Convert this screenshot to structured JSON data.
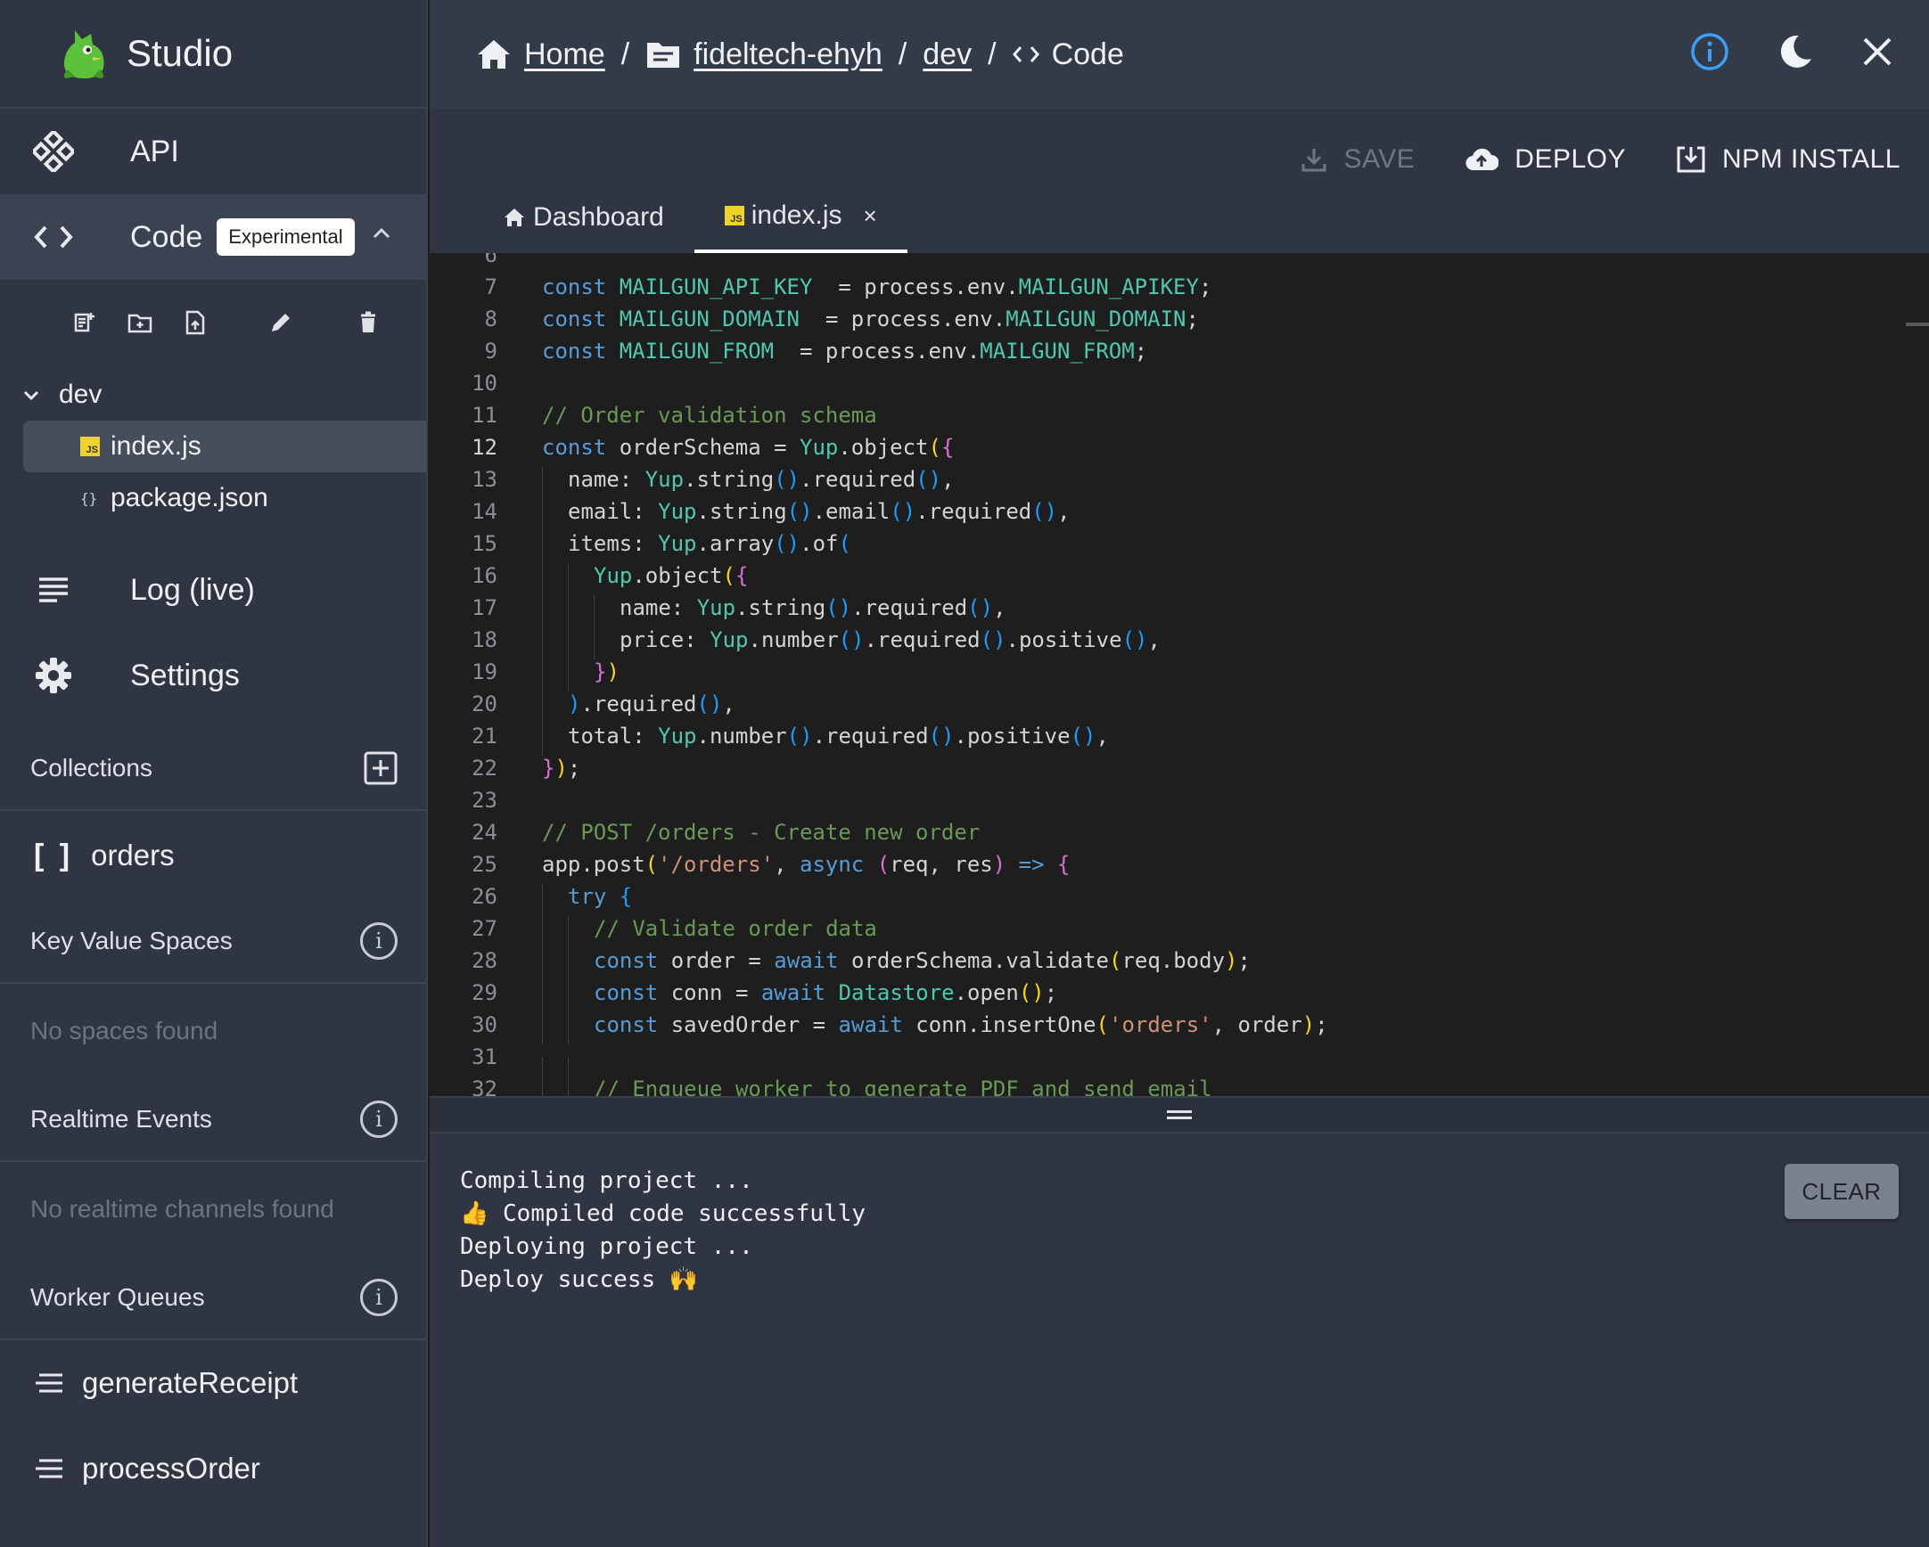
{
  "brand": {
    "name": "Studio"
  },
  "nav": {
    "api": "API",
    "code": "Code",
    "code_badge": "Experimental",
    "log": "Log (live)",
    "settings": "Settings"
  },
  "tree": {
    "folder": "dev",
    "files": [
      "index.js",
      "package.json"
    ]
  },
  "collections": {
    "title": "Collections",
    "items": [
      "orders"
    ]
  },
  "kv": {
    "title": "Key Value Spaces",
    "empty": "No spaces found"
  },
  "realtime": {
    "title": "Realtime Events",
    "empty": "No realtime channels found"
  },
  "workers": {
    "title": "Worker Queues",
    "items": [
      "generateReceipt",
      "processOrder"
    ]
  },
  "breadcrumb": {
    "home": "Home",
    "project": "fideltech-ehyh",
    "space": "dev",
    "current": "Code",
    "separator": "/"
  },
  "actions": {
    "save": "SAVE",
    "deploy": "DEPLOY",
    "npm": "NPM INSTALL"
  },
  "tabs": {
    "dashboard": "Dashboard",
    "file": "index.js",
    "close": "×"
  },
  "code": {
    "current_line": 12,
    "lines": [
      {
        "n": 6,
        "indent": 0,
        "t": [
          [
            "",
            ""
          ]
        ]
      },
      {
        "n": 7,
        "indent": 0,
        "t": [
          [
            "kw",
            "const "
          ],
          [
            "cst",
            "MAILGUN_API_KEY"
          ],
          [
            "",
            "  = process.env."
          ],
          [
            "cst",
            "MAILGUN_APIKEY"
          ],
          [
            "",
            ";"
          ]
        ]
      },
      {
        "n": 8,
        "indent": 0,
        "t": [
          [
            "kw",
            "const "
          ],
          [
            "cst",
            "MAILGUN_DOMAIN"
          ],
          [
            "",
            "  = process.env."
          ],
          [
            "cst",
            "MAILGUN_DOMAIN"
          ],
          [
            "",
            ";"
          ]
        ]
      },
      {
        "n": 9,
        "indent": 0,
        "t": [
          [
            "kw",
            "const "
          ],
          [
            "cst",
            "MAILGUN_FROM"
          ],
          [
            "",
            "  = process.env."
          ],
          [
            "cst",
            "MAILGUN_FROM"
          ],
          [
            "",
            ";"
          ]
        ]
      },
      {
        "n": 10,
        "indent": 0,
        "t": []
      },
      {
        "n": 11,
        "indent": 0,
        "t": [
          [
            "com",
            "// Order validation schema"
          ]
        ]
      },
      {
        "n": 12,
        "indent": 0,
        "t": [
          [
            "kw",
            "const "
          ],
          [
            "",
            "orderSchema = "
          ],
          [
            "cst",
            "Yup"
          ],
          [
            "",
            ".object"
          ],
          [
            "p1",
            "("
          ],
          [
            "p2",
            "{"
          ]
        ]
      },
      {
        "n": 13,
        "indent": 1,
        "t": [
          [
            "",
            "name: "
          ],
          [
            "cst",
            "Yup"
          ],
          [
            "",
            ".string"
          ],
          [
            "p3",
            "()"
          ],
          [
            "",
            ".required"
          ],
          [
            "p3",
            "()"
          ],
          [
            "",
            ","
          ]
        ]
      },
      {
        "n": 14,
        "indent": 1,
        "t": [
          [
            "",
            "email: "
          ],
          [
            "cst",
            "Yup"
          ],
          [
            "",
            ".string"
          ],
          [
            "p3",
            "()"
          ],
          [
            "",
            ".email"
          ],
          [
            "p3",
            "()"
          ],
          [
            "",
            ".required"
          ],
          [
            "p3",
            "()"
          ],
          [
            "",
            ","
          ]
        ]
      },
      {
        "n": 15,
        "indent": 1,
        "t": [
          [
            "",
            "items: "
          ],
          [
            "cst",
            "Yup"
          ],
          [
            "",
            ".array"
          ],
          [
            "p3",
            "()"
          ],
          [
            "",
            ".of"
          ],
          [
            "p3",
            "("
          ]
        ]
      },
      {
        "n": 16,
        "indent": 2,
        "t": [
          [
            "cst",
            "Yup"
          ],
          [
            "",
            ".object"
          ],
          [
            "p1",
            "("
          ],
          [
            "p2",
            "{"
          ]
        ]
      },
      {
        "n": 17,
        "indent": 3,
        "t": [
          [
            "",
            "name: "
          ],
          [
            "cst",
            "Yup"
          ],
          [
            "",
            ".string"
          ],
          [
            "p3",
            "()"
          ],
          [
            "",
            ".required"
          ],
          [
            "p3",
            "()"
          ],
          [
            "",
            ","
          ]
        ]
      },
      {
        "n": 18,
        "indent": 3,
        "t": [
          [
            "",
            "price: "
          ],
          [
            "cst",
            "Yup"
          ],
          [
            "",
            ".number"
          ],
          [
            "p3",
            "()"
          ],
          [
            "",
            ".required"
          ],
          [
            "p3",
            "()"
          ],
          [
            "",
            ".positive"
          ],
          [
            "p3",
            "()"
          ],
          [
            "",
            ","
          ]
        ]
      },
      {
        "n": 19,
        "indent": 2,
        "t": [
          [
            "p2",
            "}"
          ],
          [
            "p1",
            ")"
          ]
        ]
      },
      {
        "n": 20,
        "indent": 1,
        "t": [
          [
            "p3",
            ")"
          ],
          [
            "",
            ".required"
          ],
          [
            "p3",
            "()"
          ],
          [
            "",
            ","
          ]
        ]
      },
      {
        "n": 21,
        "indent": 1,
        "t": [
          [
            "",
            "total: "
          ],
          [
            "cst",
            "Yup"
          ],
          [
            "",
            ".number"
          ],
          [
            "p3",
            "()"
          ],
          [
            "",
            ".required"
          ],
          [
            "p3",
            "()"
          ],
          [
            "",
            ".positive"
          ],
          [
            "p3",
            "()"
          ],
          [
            "",
            ","
          ]
        ]
      },
      {
        "n": 22,
        "indent": 0,
        "t": [
          [
            "p2",
            "}"
          ],
          [
            "p1",
            ")"
          ],
          [
            "",
            ";"
          ]
        ]
      },
      {
        "n": 23,
        "indent": 0,
        "t": []
      },
      {
        "n": 24,
        "indent": 0,
        "t": [
          [
            "com",
            "// POST /orders - Create new order"
          ]
        ]
      },
      {
        "n": 25,
        "indent": 0,
        "t": [
          [
            "",
            "app.post"
          ],
          [
            "p1",
            "("
          ],
          [
            "str",
            "'/orders'"
          ],
          [
            "",
            ", "
          ],
          [
            "kw",
            "async "
          ],
          [
            "p2",
            "("
          ],
          [
            "",
            "req, res"
          ],
          [
            "p2",
            ")"
          ],
          [
            "kw",
            " => "
          ],
          [
            "p2",
            "{"
          ]
        ]
      },
      {
        "n": 26,
        "indent": 1,
        "t": [
          [
            "kw",
            "try "
          ],
          [
            "p3",
            "{"
          ]
        ]
      },
      {
        "n": 27,
        "indent": 2,
        "t": [
          [
            "com",
            "// Validate order data"
          ]
        ]
      },
      {
        "n": 28,
        "indent": 2,
        "t": [
          [
            "kw",
            "const "
          ],
          [
            "",
            "order = "
          ],
          [
            "kw",
            "await "
          ],
          [
            "",
            "orderSchema.validate"
          ],
          [
            "p1",
            "("
          ],
          [
            "",
            "req.body"
          ],
          [
            "p1",
            ")"
          ],
          [
            "",
            ";"
          ]
        ]
      },
      {
        "n": 29,
        "indent": 2,
        "t": [
          [
            "kw",
            "const "
          ],
          [
            "",
            "conn = "
          ],
          [
            "kw",
            "await "
          ],
          [
            "cst",
            "Datastore"
          ],
          [
            "",
            ".open"
          ],
          [
            "p1",
            "()"
          ],
          [
            "",
            ";"
          ]
        ]
      },
      {
        "n": 30,
        "indent": 2,
        "t": [
          [
            "kw",
            "const "
          ],
          [
            "",
            "savedOrder = "
          ],
          [
            "kw",
            "await "
          ],
          [
            "",
            "conn.insertOne"
          ],
          [
            "p1",
            "("
          ],
          [
            "str",
            "'orders'"
          ],
          [
            "",
            ", order"
          ],
          [
            "p1",
            ")"
          ],
          [
            "",
            ";"
          ]
        ]
      },
      {
        "n": 31,
        "indent": 2,
        "t": []
      },
      {
        "n": 32,
        "indent": 2,
        "t": [
          [
            "com",
            "// Enqueue worker to generate PDF and send email"
          ]
        ]
      }
    ]
  },
  "console": {
    "lines": [
      "Compiling project ...",
      "👍 Compiled code successfully",
      "Deploying project ...",
      "Deploy success 🙌"
    ],
    "clear": "CLEAR"
  }
}
